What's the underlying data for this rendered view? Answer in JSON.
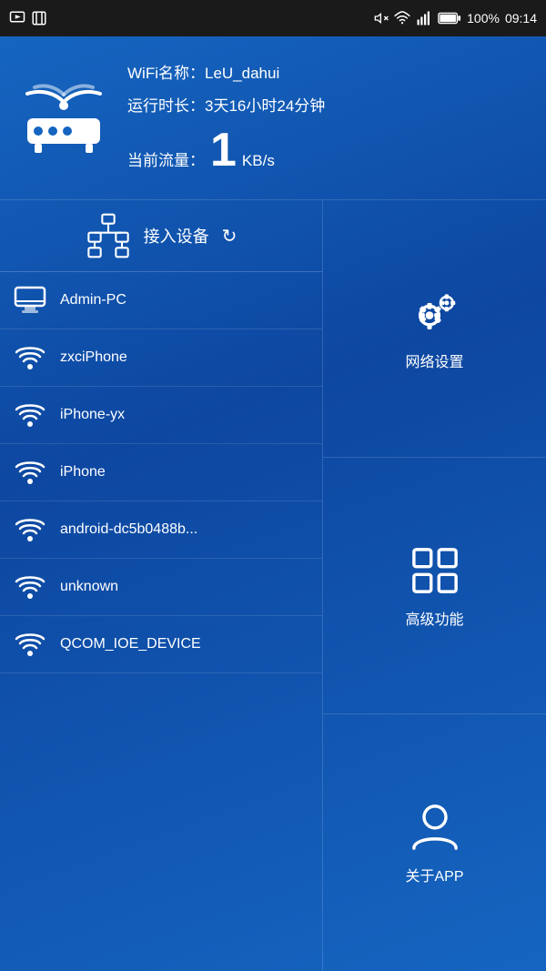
{
  "statusBar": {
    "time": "09:14",
    "battery": "100%",
    "icons": [
      "screen-record",
      "screenshot",
      "mute",
      "wifi",
      "signal"
    ]
  },
  "topPanel": {
    "wifiLabel": "WiFi名称：LeU_dahui",
    "uptimeLabel": "运行时长：3天16小时24分钟",
    "flowLabel": "当前流量：",
    "flowNumber": "1",
    "flowUnit": "KB/s"
  },
  "devicesSection": {
    "title": "接入设备",
    "devices": [
      {
        "name": "Admin-PC",
        "type": "wired"
      },
      {
        "name": "zxciPhone",
        "type": "wifi"
      },
      {
        "name": "iPhone-yx",
        "type": "wifi"
      },
      {
        "name": "iPhone",
        "type": "wifi"
      },
      {
        "name": "android-dc5b0488b...",
        "type": "wifi"
      },
      {
        "name": "unknown",
        "type": "wifi"
      },
      {
        "name": "QCOM_IOE_DEVICE",
        "type": "wifi"
      }
    ]
  },
  "rightPanel": {
    "items": [
      {
        "key": "network-settings",
        "label": "网络设置"
      },
      {
        "key": "advanced-features",
        "label": "高级功能"
      },
      {
        "key": "about-app",
        "label": "关于APP"
      }
    ]
  }
}
